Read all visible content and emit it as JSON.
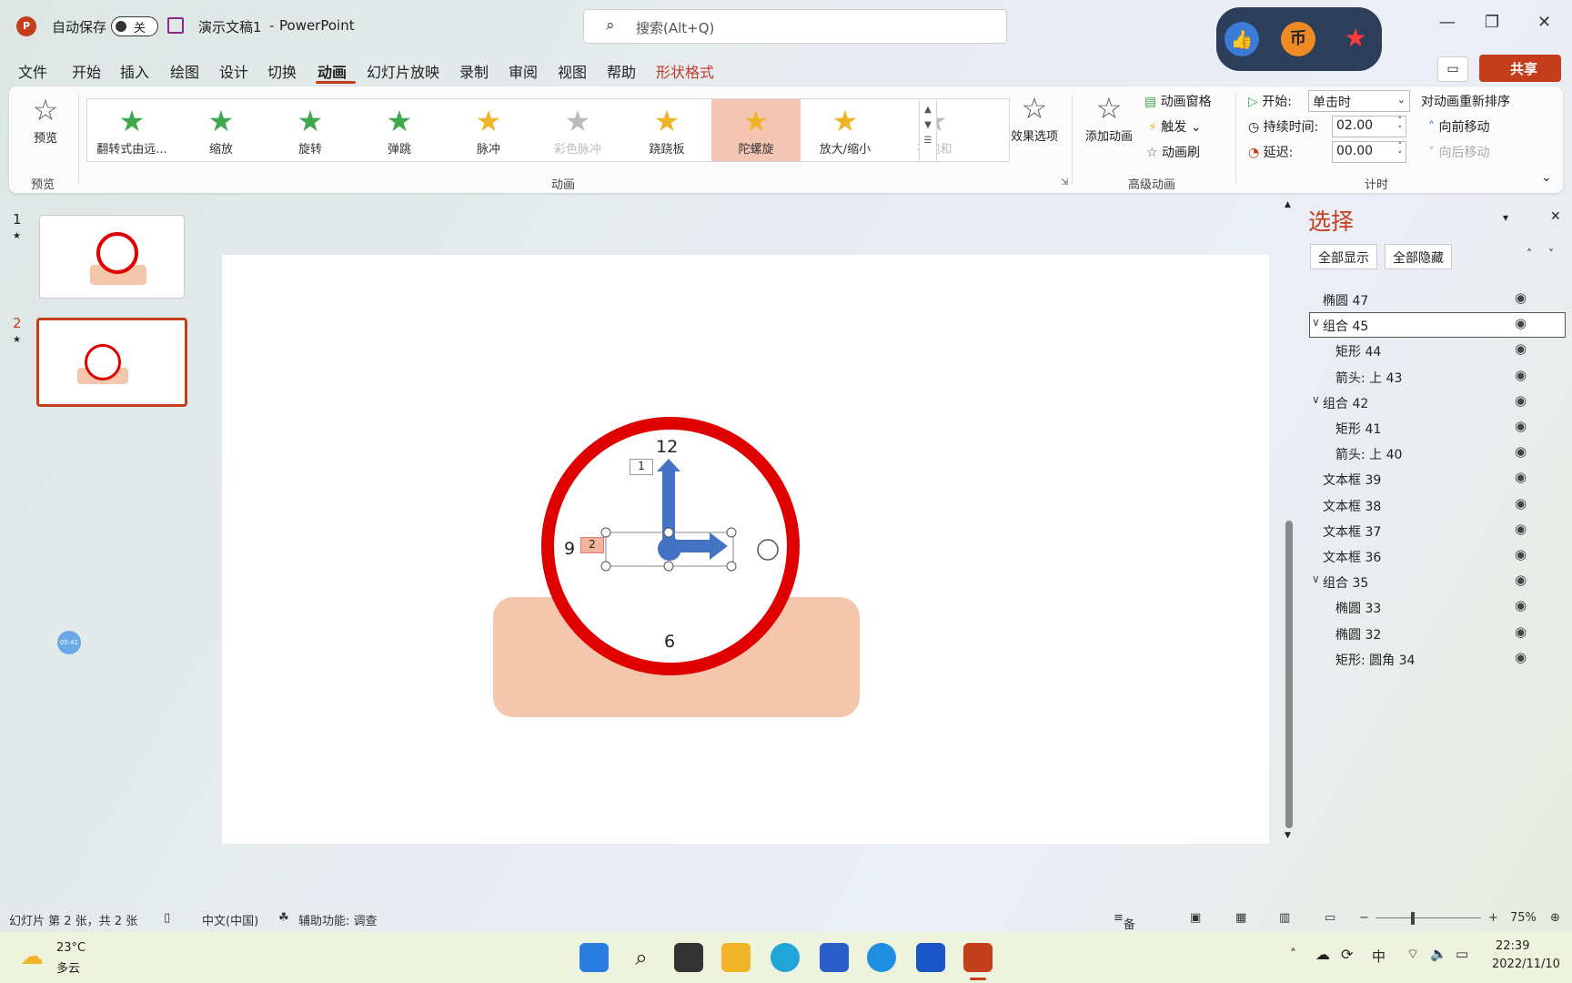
{
  "titlebar": {
    "autosave_label": "自动保存",
    "autosave_state": "关",
    "doc_title": "演示文稿1",
    "separator": "-",
    "app_name": "PowerPoint",
    "search_placeholder": "搜索(Alt+Q)"
  },
  "menu": {
    "items": [
      "文件",
      "开始",
      "插入",
      "绘图",
      "设计",
      "切换",
      "动画",
      "幻灯片放映",
      "录制",
      "审阅",
      "视图",
      "帮助",
      "形状格式"
    ],
    "share": "共享"
  },
  "ribbon": {
    "preview": "预览",
    "preview_group": "预览",
    "animations": [
      "翻转式由远...",
      "缩放",
      "旋转",
      "弹跳",
      "脉冲",
      "彩色脉冲",
      "跷跷板",
      "陀螺旋",
      "放大/缩小",
      "不饱和"
    ],
    "animation_group": "动画",
    "effect_options": "效果选项",
    "add_animation": "添加动画",
    "animation_pane": "动画窗格",
    "trigger": "触发",
    "animation_painter": "动画刷",
    "advanced_group": "高级动画",
    "start_label": "开始:",
    "start_value": "单击时",
    "duration_label": "持续时间:",
    "duration_value": "02.00",
    "delay_label": "延迟:",
    "delay_value": "00.00",
    "timing_group": "计时",
    "reorder_title": "对动画重新排序",
    "move_earlier": "向前移动",
    "move_later": "向后移动"
  },
  "thumbnails": [
    {
      "num": "1"
    },
    {
      "num": "2"
    }
  ],
  "slide": {
    "clock_12": "12",
    "clock_9": "9",
    "clock_6": "6",
    "tag_1": "1",
    "tag_2": "2",
    "bubble": "05:41"
  },
  "selection_pane": {
    "title": "选择",
    "show_all": "全部显示",
    "hide_all": "全部隐藏",
    "items": [
      {
        "name": "椭圆 47",
        "indent": 0,
        "chevron": ""
      },
      {
        "name": "组合 45",
        "indent": 0,
        "chevron": "∨"
      },
      {
        "name": "矩形 44",
        "indent": 1,
        "chevron": ""
      },
      {
        "name": "箭头: 上 43",
        "indent": 1,
        "chevron": ""
      },
      {
        "name": "组合 42",
        "indent": 0,
        "chevron": "∨"
      },
      {
        "name": "矩形 41",
        "indent": 1,
        "chevron": ""
      },
      {
        "name": "箭头: 上 40",
        "indent": 1,
        "chevron": ""
      },
      {
        "name": "文本框 39",
        "indent": 0,
        "chevron": ""
      },
      {
        "name": "文本框 38",
        "indent": 0,
        "chevron": ""
      },
      {
        "name": "文本框 37",
        "indent": 0,
        "chevron": ""
      },
      {
        "name": "文本框 36",
        "indent": 0,
        "chevron": ""
      },
      {
        "name": "组合 35",
        "indent": 0,
        "chevron": "∨"
      },
      {
        "name": "椭圆 33",
        "indent": 1,
        "chevron": ""
      },
      {
        "name": "椭圆 32",
        "indent": 1,
        "chevron": ""
      },
      {
        "name": "矩形: 圆角 34",
        "indent": 1,
        "chevron": ""
      }
    ]
  },
  "statusbar": {
    "slide_info": "幻灯片 第 2 张，共 2 张",
    "language": "中文(中国)",
    "accessibility": "辅助功能: 调查",
    "notes": "备注",
    "zoom": "75%"
  },
  "taskbar": {
    "temp": "23°C",
    "weather": "多云",
    "ime": "中",
    "time": "22:39",
    "date": "2022/11/10"
  },
  "colors": {
    "accent": "#c43e1c",
    "clock_red": "#e00000",
    "blue": "#4472c4",
    "peach": "#f4c7ad"
  }
}
